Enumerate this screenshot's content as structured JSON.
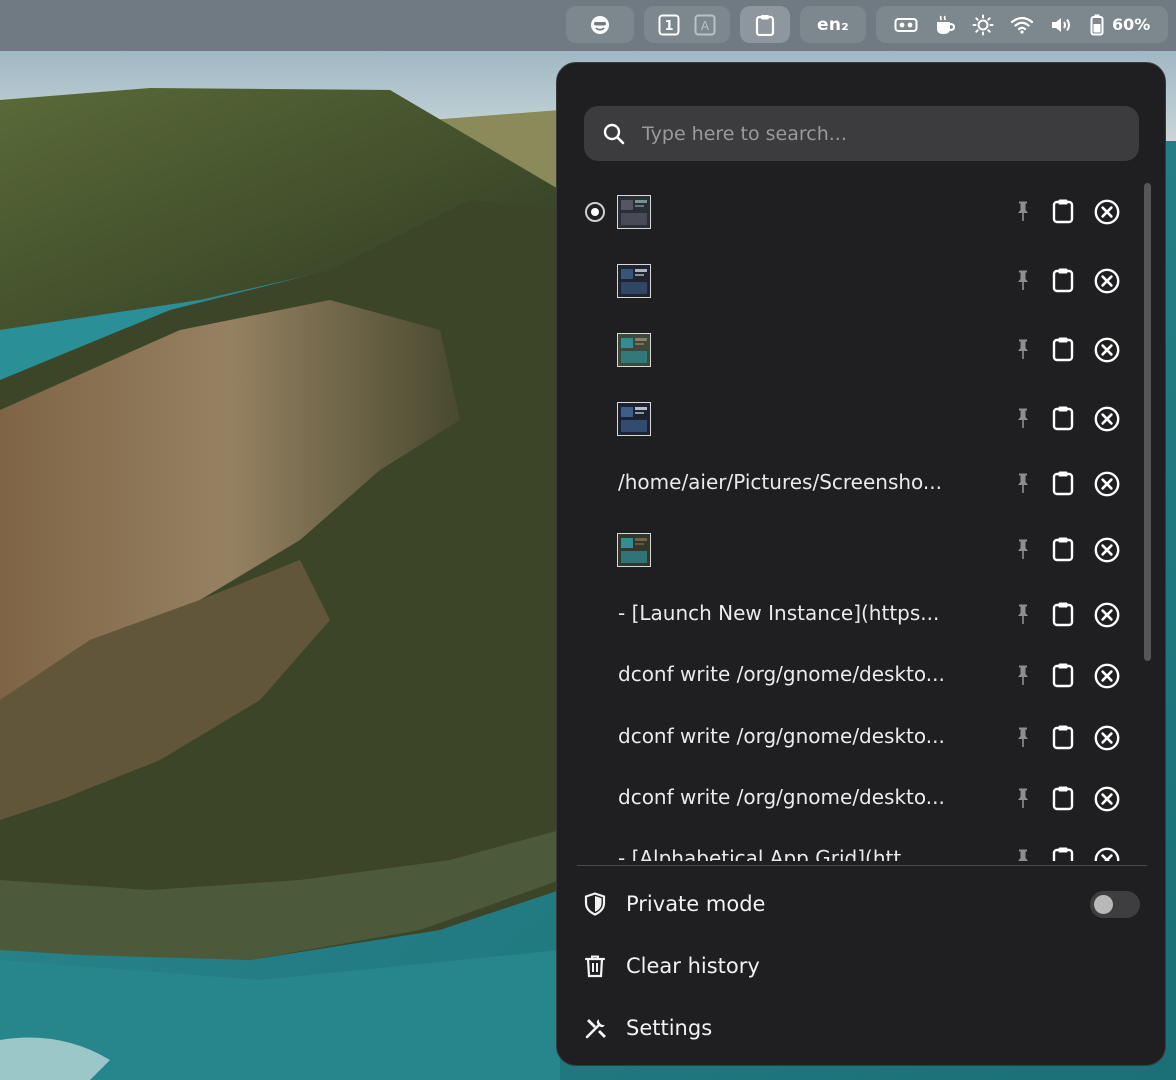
{
  "topbar": {
    "workspace_1": "1",
    "workspace_2": "A",
    "keyboard_layout": "en₂",
    "battery_percent": "60%",
    "icons": [
      "face-icon",
      "workspace-1-icon",
      "workspace-a-icon",
      "clipboard-indicator-icon",
      "vr-icon",
      "coffee-icon",
      "brightness-icon",
      "wifi-icon",
      "volume-icon",
      "battery-icon"
    ]
  },
  "popup": {
    "search": {
      "placeholder": "Type here to search...",
      "value": ""
    },
    "history": [
      {
        "kind": "image",
        "selected": true,
        "text": "",
        "thumb": "screenshot-dark"
      },
      {
        "kind": "image",
        "selected": false,
        "text": "",
        "thumb": "screenshot-menu"
      },
      {
        "kind": "image",
        "selected": false,
        "text": "",
        "thumb": "screenshot-landscape"
      },
      {
        "kind": "image",
        "selected": false,
        "text": "",
        "thumb": "screenshot-dialog"
      },
      {
        "kind": "text",
        "selected": false,
        "text": "/home/aier/Pictures/Screensho..."
      },
      {
        "kind": "image",
        "selected": false,
        "text": "",
        "thumb": "screenshot-landscape-2"
      },
      {
        "kind": "text",
        "selected": false,
        "text": "- [Launch New Instance](https..."
      },
      {
        "kind": "text",
        "selected": false,
        "text": "dconf write /org/gnome/deskto..."
      },
      {
        "kind": "text",
        "selected": false,
        "text": "dconf write /org/gnome/deskto..."
      },
      {
        "kind": "text",
        "selected": false,
        "text": "dconf write /org/gnome/deskto..."
      },
      {
        "kind": "text",
        "selected": false,
        "text": "- [Alphabetical App Grid](htt..."
      }
    ],
    "row_actions": {
      "pin": "pin-icon",
      "copy": "copy-to-clipboard-icon",
      "delete": "delete-entry-icon"
    },
    "menu": {
      "private_mode": "Private mode",
      "private_mode_enabled": false,
      "clear_history": "Clear history",
      "settings": "Settings"
    }
  },
  "colors": {
    "topbar": "#6f7a82",
    "popup_bg": "#1f1f21",
    "search_bg": "#3c3c3e",
    "text": "#f0f0f0"
  }
}
